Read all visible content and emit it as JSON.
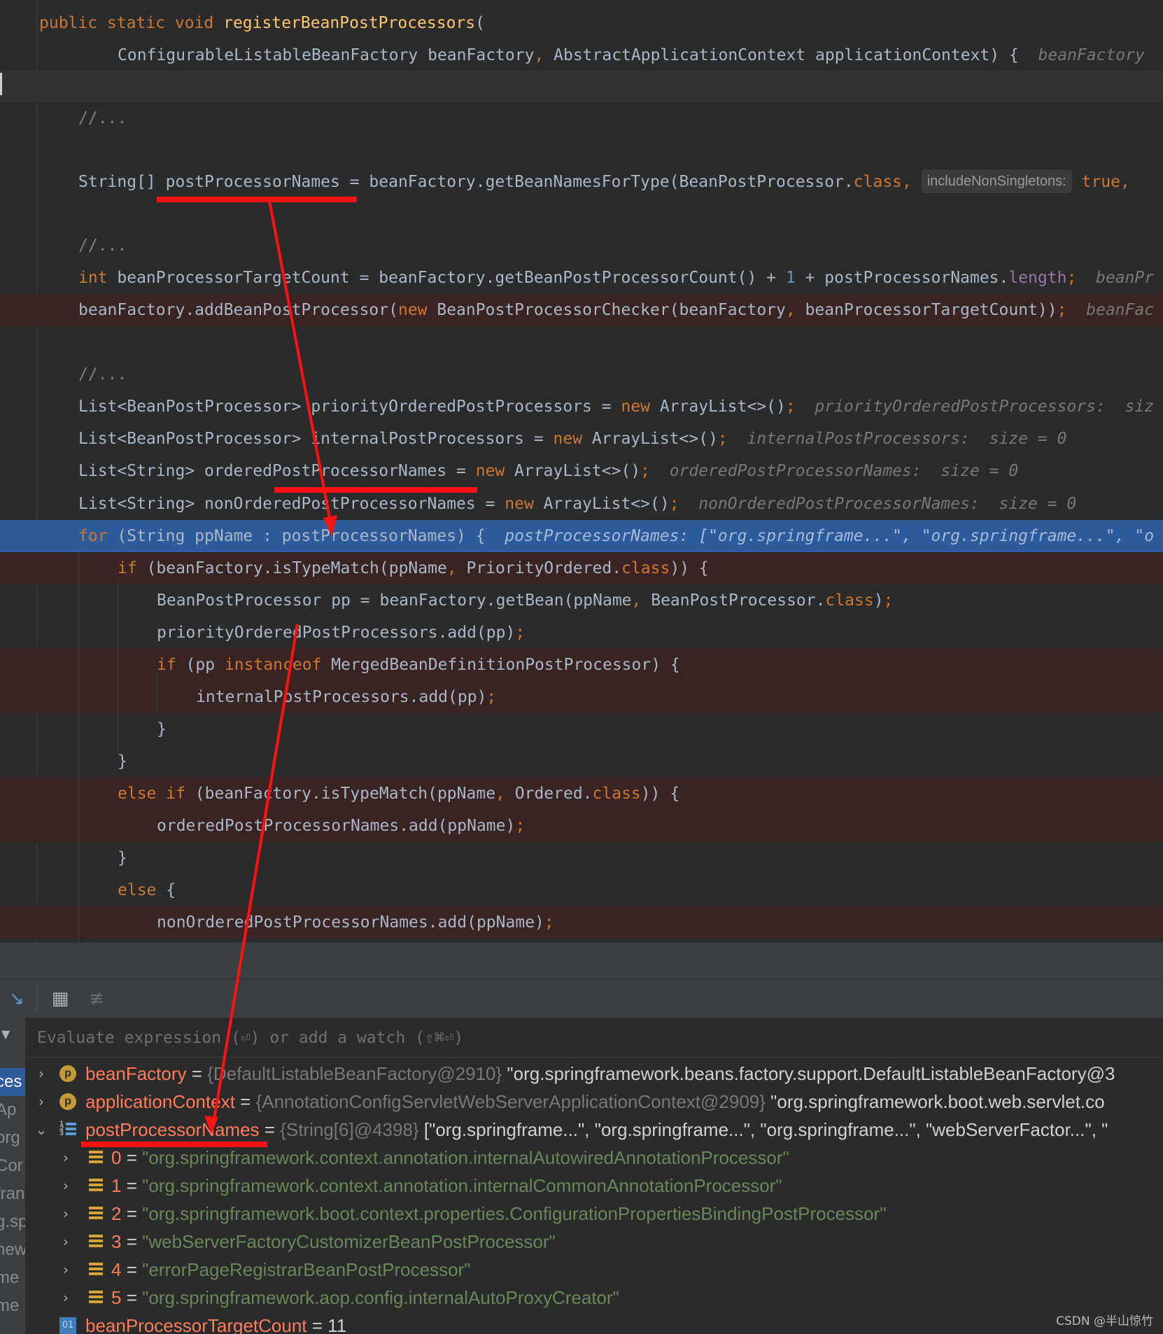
{
  "editor": {
    "lines": [
      {
        "style": "normal",
        "tokens": [
          {
            "c": "kw",
            "t": "public static void "
          },
          {
            "c": "fn",
            "t": "registerBeanPostProcessors"
          },
          {
            "c": "",
            "t": "("
          }
        ]
      },
      {
        "style": "normal",
        "tokens": [
          {
            "c": "",
            "t": "ConfigurableListableBeanFactory beanFactory"
          },
          {
            "c": "kw",
            "t": ", "
          },
          {
            "c": "",
            "t": "AbstractApplicationContext applicationContext) {  "
          },
          {
            "c": "hint",
            "t": "beanFactory"
          }
        ]
      },
      {
        "style": "caretline",
        "tokens": []
      },
      {
        "style": "normal",
        "tokens": [
          {
            "c": "cmt",
            "t": "//..."
          }
        ]
      },
      {
        "style": "normal",
        "tokens": []
      },
      {
        "style": "normal",
        "tokens": [
          {
            "c": "",
            "t": "String[] postProcessorNames = beanFactory.getBeanNamesForType(BeanPostProcessor."
          },
          {
            "c": "kw",
            "t": "class, "
          },
          {
            "c": "param",
            "t": "includeNonSingletons:"
          },
          {
            "c": "kw",
            "t": " true,"
          }
        ]
      },
      {
        "style": "normal",
        "tokens": []
      },
      {
        "style": "normal",
        "tokens": [
          {
            "c": "cmt",
            "t": "//..."
          }
        ]
      },
      {
        "style": "normal",
        "tokens": [
          {
            "c": "kw",
            "t": "int "
          },
          {
            "c": "",
            "t": "beanProcessorTargetCount = beanFactory.getBeanPostProcessorCount() + "
          },
          {
            "c": "num",
            "t": "1"
          },
          {
            "c": "",
            "t": " + postProcessorNames."
          },
          {
            "c": "field",
            "t": "length"
          },
          {
            "c": "kw",
            "t": ";  "
          },
          {
            "c": "hint",
            "t": "beanPr"
          }
        ]
      },
      {
        "style": "bp",
        "tokens": [
          {
            "c": "",
            "t": "beanFactory.addBeanPostProcessor("
          },
          {
            "c": "kw",
            "t": "new "
          },
          {
            "c": "",
            "t": "BeanPostProcessorChecker(beanFactory"
          },
          {
            "c": "kw",
            "t": ", "
          },
          {
            "c": "",
            "t": "beanProcessorTargetCount))"
          },
          {
            "c": "kw",
            "t": ";  "
          },
          {
            "c": "hint",
            "t": "beanFac"
          }
        ]
      },
      {
        "style": "normal",
        "tokens": []
      },
      {
        "style": "normal",
        "tokens": [
          {
            "c": "cmt",
            "t": "//..."
          }
        ]
      },
      {
        "style": "normal",
        "tokens": [
          {
            "c": "",
            "t": "List<BeanPostProcessor> priorityOrderedPostProcessors = "
          },
          {
            "c": "kw",
            "t": "new "
          },
          {
            "c": "",
            "t": "ArrayList<>()"
          },
          {
            "c": "kw",
            "t": ";  "
          },
          {
            "c": "hint",
            "t": "priorityOrderedPostProcessors:  siz"
          }
        ]
      },
      {
        "style": "normal",
        "tokens": [
          {
            "c": "",
            "t": "List<BeanPostProcessor> internalPostProcessors = "
          },
          {
            "c": "kw",
            "t": "new "
          },
          {
            "c": "",
            "t": "ArrayList<>()"
          },
          {
            "c": "kw",
            "t": ";  "
          },
          {
            "c": "hint",
            "t": "internalPostProcessors:  size = 0"
          }
        ]
      },
      {
        "style": "normal",
        "tokens": [
          {
            "c": "",
            "t": "List<String> orderedPostProcessorNames = "
          },
          {
            "c": "kw",
            "t": "new "
          },
          {
            "c": "",
            "t": "ArrayList<>()"
          },
          {
            "c": "kw",
            "t": ";  "
          },
          {
            "c": "hint",
            "t": "orderedPostProcessorNames:  size = 0"
          }
        ]
      },
      {
        "style": "normal",
        "tokens": [
          {
            "c": "",
            "t": "List<String> nonOrderedPostProcessorNames = "
          },
          {
            "c": "kw",
            "t": "new "
          },
          {
            "c": "",
            "t": "ArrayList<>()"
          },
          {
            "c": "kw",
            "t": ";  "
          },
          {
            "c": "hint",
            "t": "nonOrderedPostProcessorNames:  size = 0"
          }
        ]
      },
      {
        "style": "current",
        "tokens": [
          {
            "c": "kw",
            "t": "for "
          },
          {
            "c": "",
            "t": "(String ppName : postProcessorNames) {  "
          },
          {
            "c": "hint",
            "t": "postProcessorNames: [\"org.springframe...\", \"org.springframe...\", \"o"
          }
        ]
      },
      {
        "style": "bp",
        "tokens": [
          {
            "c": "kw",
            "t": "if "
          },
          {
            "c": "",
            "t": "(beanFactory.isTypeMatch(ppName"
          },
          {
            "c": "kw",
            "t": ", "
          },
          {
            "c": "",
            "t": "PriorityOrdered."
          },
          {
            "c": "kw",
            "t": "class"
          },
          {
            "c": "",
            "t": ")) {"
          }
        ]
      },
      {
        "style": "normal",
        "tokens": [
          {
            "c": "",
            "t": "BeanPostProcessor pp = beanFactory.getBean(ppName"
          },
          {
            "c": "kw",
            "t": ", "
          },
          {
            "c": "",
            "t": "BeanPostProcessor."
          },
          {
            "c": "kw",
            "t": "class"
          },
          {
            "c": "",
            "t": ")"
          },
          {
            "c": "kw",
            "t": ";"
          }
        ]
      },
      {
        "style": "normal",
        "tokens": [
          {
            "c": "",
            "t": "priorityOrderedPostProcessors.add(pp)"
          },
          {
            "c": "kw",
            "t": ";"
          }
        ]
      },
      {
        "style": "bp",
        "tokens": [
          {
            "c": "kw",
            "t": "if "
          },
          {
            "c": "",
            "t": "(pp "
          },
          {
            "c": "kw",
            "t": "instanceof "
          },
          {
            "c": "",
            "t": "MergedBeanDefinitionPostProcessor) {"
          }
        ]
      },
      {
        "style": "bp",
        "tokens": [
          {
            "c": "",
            "t": "internalPostProcessors.add(pp)"
          },
          {
            "c": "kw",
            "t": ";"
          }
        ]
      },
      {
        "style": "normal",
        "tokens": [
          {
            "c": "",
            "t": "}"
          }
        ]
      },
      {
        "style": "normal",
        "tokens": [
          {
            "c": "",
            "t": "}"
          }
        ]
      },
      {
        "style": "bp",
        "tokens": [
          {
            "c": "kw",
            "t": "else if "
          },
          {
            "c": "",
            "t": "(beanFactory.isTypeMatch(ppName"
          },
          {
            "c": "kw",
            "t": ", "
          },
          {
            "c": "",
            "t": "Ordered."
          },
          {
            "c": "kw",
            "t": "class"
          },
          {
            "c": "",
            "t": ")) {"
          }
        ]
      },
      {
        "style": "bp",
        "tokens": [
          {
            "c": "",
            "t": "orderedPostProcessorNames.add(ppName)"
          },
          {
            "c": "kw",
            "t": ";"
          }
        ]
      },
      {
        "style": "normal",
        "tokens": [
          {
            "c": "",
            "t": "}"
          }
        ]
      },
      {
        "style": "normal",
        "tokens": [
          {
            "c": "kw",
            "t": "else "
          },
          {
            "c": "",
            "t": "{"
          }
        ]
      },
      {
        "style": "bp",
        "tokens": [
          {
            "c": "",
            "t": "nonOrderedPostProcessorNames.add(ppName)"
          },
          {
            "c": "kw",
            "t": ";"
          }
        ]
      }
    ]
  },
  "debugger": {
    "toolbar": {
      "step_icon": "step-into-cursor-icon",
      "calculator_icon": "evaluate-expression-icon",
      "lines_icon": "show-lines-icon"
    },
    "eval_placeholder": "Evaluate expression (⏎) or add a watch (⇧⌘⏎)",
    "frames": [
      "ces",
      "Ap",
      "org",
      "Cor",
      "fran",
      "g.sp",
      "new",
      "me",
      "me"
    ],
    "variables": [
      {
        "kind": "p",
        "toggle": "›",
        "name": "beanFactory",
        "type": "{DefaultListableBeanFactory@2910}",
        "value": "\"org.springframework.beans.factory.support.DefaultListableBeanFactory@3"
      },
      {
        "kind": "p",
        "toggle": "›",
        "name": "applicationContext",
        "type": "{AnnotationConfigServletWebServerApplicationContext@2909}",
        "value": "\"org.springframework.boot.web.servlet.co"
      },
      {
        "kind": "list",
        "toggle": "⌄",
        "name": "postProcessorNames",
        "type": "{String[6]@4398}",
        "value": "[\"org.springframe...\", \"org.springframe...\", \"org.springframe...\", \"webServerFactor...\", \""
      },
      {
        "kind": "arr",
        "toggle": "›",
        "index": "0",
        "value": "\"org.springframework.context.annotation.internalAutowiredAnnotationProcessor\""
      },
      {
        "kind": "arr",
        "toggle": "›",
        "index": "1",
        "value": "\"org.springframework.context.annotation.internalCommonAnnotationProcessor\""
      },
      {
        "kind": "arr",
        "toggle": "›",
        "index": "2",
        "value": "\"org.springframework.boot.context.properties.ConfigurationPropertiesBindingPostProcessor\""
      },
      {
        "kind": "arr",
        "toggle": "›",
        "index": "3",
        "value": "\"webServerFactoryCustomizerBeanPostProcessor\""
      },
      {
        "kind": "arr",
        "toggle": "›",
        "index": "4",
        "value": "\"errorPageRegistrarBeanPostProcessor\""
      },
      {
        "kind": "arr",
        "toggle": "›",
        "index": "5",
        "value": "\"org.springframework.aop.config.internalAutoProxyCreator\""
      },
      {
        "kind": "int",
        "toggle": "",
        "name": "beanProcessorTargetCount",
        "value": "11"
      }
    ]
  },
  "watermark": "CSDN @半山惊竹",
  "colors": {
    "annotation": "#ff0000",
    "current_line": "#2d5b9c",
    "breakpoint_line": "#3a2323"
  }
}
